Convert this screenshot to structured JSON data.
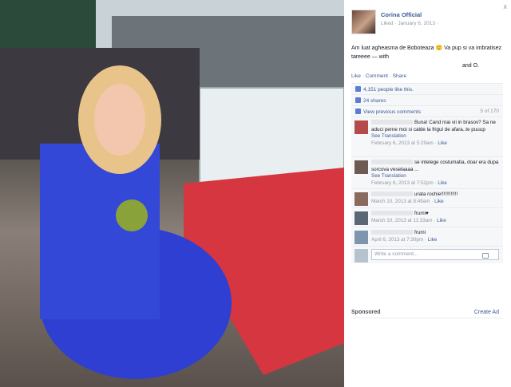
{
  "photo": {
    "alt_icons": [
      "flower-bouquet"
    ]
  },
  "post": {
    "page_name": "Corina Official",
    "meta": "Liked · January 6, 2013 ·",
    "caption_line1": "Am luat agheasma de Boboteaza 🙂 Va pup si va imbratisez tareeee — with",
    "caption_line2": "and O."
  },
  "actions": {
    "like": "Like",
    "comment": "Comment",
    "share": "Share",
    "sep": "·"
  },
  "likes_text": "4,151 people like this.",
  "shares_text": "24 shares",
  "prev_comments": {
    "label": "View previous comments",
    "count": "5 of 170"
  },
  "comments": [
    {
      "text": "Buna! Cand mai vii in brasov? Sa ne aduci perne moi si calde la frigul de afara..te puuup",
      "translate": "See Translation",
      "meta": "February 6, 2013 at 5:29am ·",
      "like": "Like"
    },
    {
      "text": "se intelege costumatia, doar era dupa sorcova veselaaaa ...",
      "translate": "See Translation",
      "meta": "February 6, 2013 at 7:52pm ·",
      "like": "Like"
    },
    {
      "text": "urata rochie!!!!!!!!!!!!",
      "translate": "",
      "meta": "March 10, 2013 at 8:49am ·",
      "like": "Like"
    },
    {
      "text": "frumi♥",
      "translate": "",
      "meta": "March 10, 2013 at 11:33am ·",
      "like": "Like"
    },
    {
      "text": "frumi",
      "translate": "",
      "meta": "April 6, 2013 at 7:30pm ·",
      "like": "Like"
    }
  ],
  "write_placeholder": "Write a comment...",
  "sponsored": "Sponsored",
  "create_ad": "Create Ad",
  "close": "x",
  "colors": {
    "link": "#3b5998",
    "muted": "#9197a3",
    "panel_bg": "#f6f7f9"
  }
}
